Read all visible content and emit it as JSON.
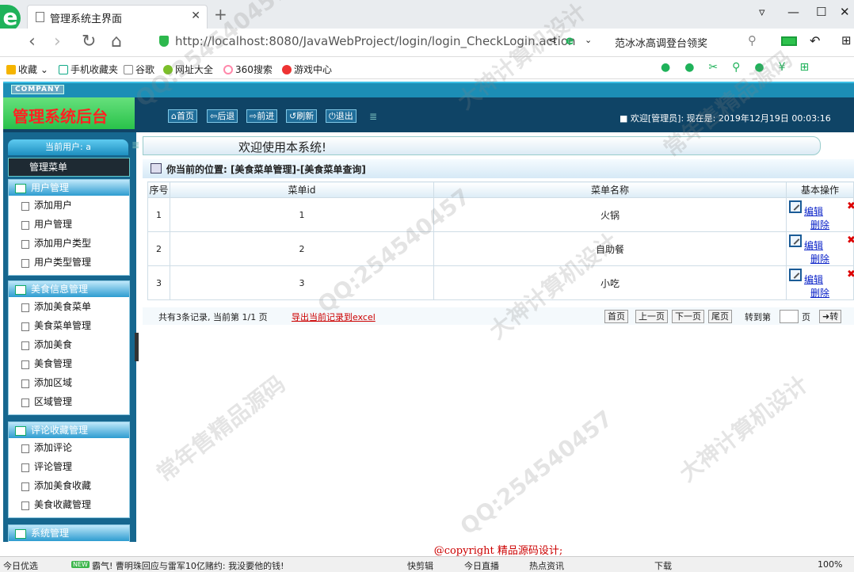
{
  "browser": {
    "tab_title": "管理系统主界面",
    "url": "http://localhost:8080/JavaWebProject/login/login_CheckLogin.action",
    "search_suggestion": "范冰冰高调登台领奖",
    "bookmarks": [
      "收藏",
      "手机收藏夹",
      "谷歌",
      "网址大全",
      "360搜索",
      "游戏中心"
    ]
  },
  "header": {
    "company_badge": "COMPANY",
    "brand": "管理系统后台",
    "buttons": [
      "首页",
      "后退",
      "前进",
      "刷新",
      "退出"
    ],
    "welcome": "欢迎[管理员]:   现在是: 2019年12月19日 00:03:16"
  },
  "sidebar": {
    "current_user_label": "当前用户: a",
    "main_menu": "管理菜单",
    "groups": [
      {
        "title": "用户管理",
        "items": [
          "添加用户",
          "用户管理",
          "添加用户类型",
          "用户类型管理"
        ]
      },
      {
        "title": "美食信息管理",
        "items": [
          "添加美食菜单",
          "美食菜单管理",
          "添加美食",
          "美食管理",
          "添加区域",
          "区域管理"
        ]
      },
      {
        "title": "评论收藏管理",
        "items": [
          "添加评论",
          "评论管理",
          "添加美食收藏",
          "美食收藏管理"
        ]
      },
      {
        "title": "系统管理",
        "items": []
      }
    ]
  },
  "content": {
    "welcome_text": "欢迎使用本系统!",
    "position_text": "你当前的位置: [美食菜单管理]-[美食菜单查询]",
    "table": {
      "headers": [
        "序号",
        "菜单id",
        "菜单名称",
        "基本操作"
      ],
      "rows": [
        {
          "no": "1",
          "id": "1",
          "name": "火锅"
        },
        {
          "no": "2",
          "id": "2",
          "name": "自助餐"
        },
        {
          "no": "3",
          "id": "3",
          "name": "小吃"
        }
      ],
      "edit_label": "编辑",
      "delete_label": "删除"
    },
    "footer": {
      "record_text": "共有3条记录, 当前第 1/1 页",
      "export_link": "导出当前记录到excel",
      "first": "首页",
      "prev": "上一页",
      "next": "下一页",
      "last": "尾页",
      "goto_label": "转到第",
      "page_unit": "页",
      "go": "➜转"
    },
    "copyright": "@copyright 精品源码设计;"
  },
  "statusbar": {
    "left": "今日优选",
    "news_badge": "NEW",
    "news": "霸气! 曹明珠回应与雷军10亿赌约: 我没要他的钱!",
    "items": [
      "快剪辑",
      "今日直播",
      "热点资讯",
      "下载"
    ],
    "zoom": "100%"
  },
  "watermarks": [
    "QQ:254540457",
    "大神计算机设计",
    "常年售精品源码",
    "QQ:254540457",
    "大神计算机设计",
    "常年售精品源码",
    "QQ:254540457",
    "大神计算机设计"
  ]
}
